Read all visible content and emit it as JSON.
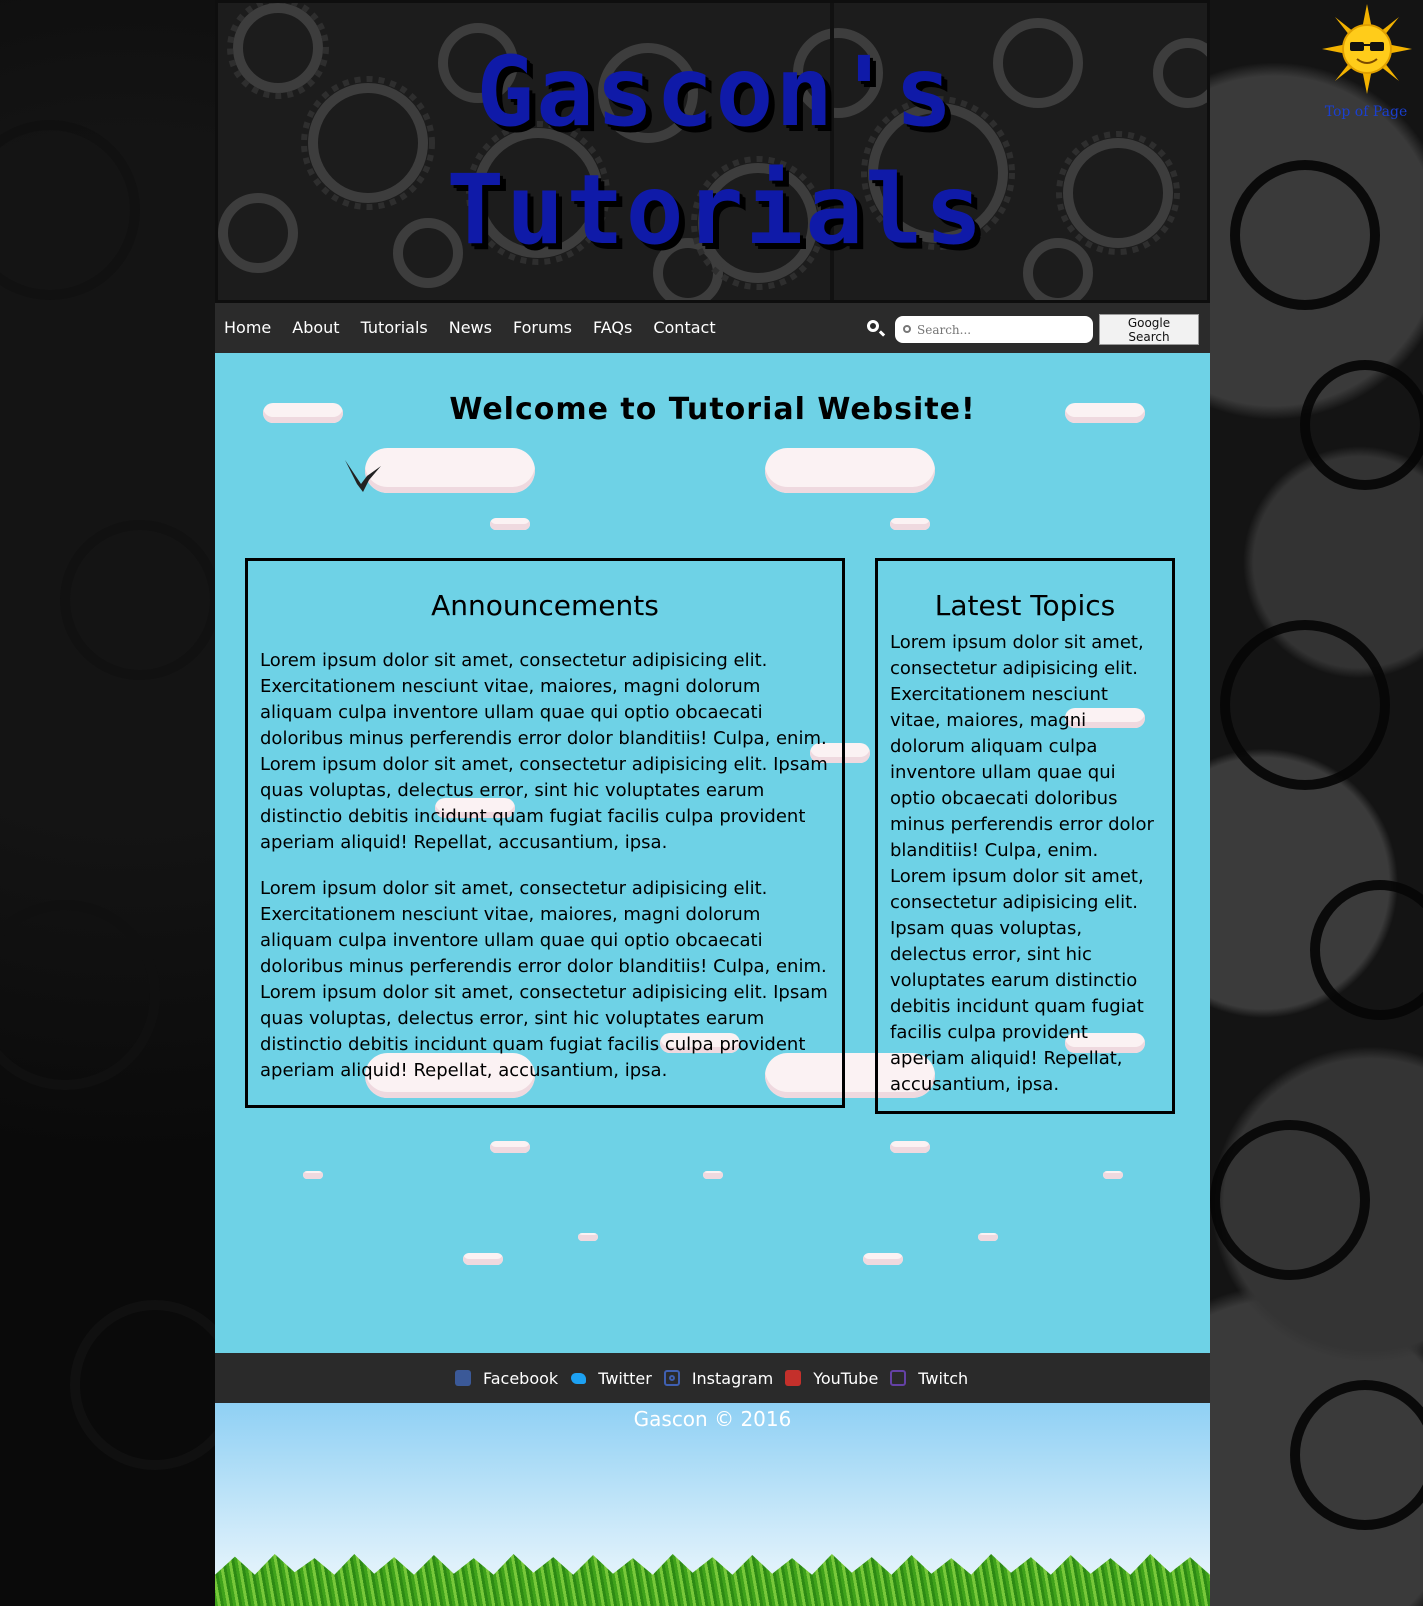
{
  "header": {
    "title_line1": "Gascon's",
    "title_line2": "Tutorials"
  },
  "nav": {
    "items": [
      "Home",
      "About",
      "Tutorials",
      "News",
      "Forums",
      "FAQs",
      "Contact"
    ],
    "search_placeholder": "Search...",
    "search_button": "Google Search"
  },
  "main": {
    "welcome": "Welcome to Tutorial Website!",
    "announcements": {
      "title": "Announcements",
      "paragraphs": [
        "Lorem ipsum dolor sit amet, consectetur adipisicing elit. Exercitationem nesciunt vitae, maiores, magni dolorum aliquam culpa inventore ullam quae qui optio obcaecati doloribus minus perferendis error dolor blanditiis! Culpa, enim. Lorem ipsum dolor sit amet, consectetur adipisicing elit. Ipsam quas voluptas, delectus error, sint hic voluptates earum distinctio debitis incidunt quam fugiat facilis culpa provident aperiam aliquid! Repellat, accusantium, ipsa.",
        "Lorem ipsum dolor sit amet, consectetur adipisicing elit. Exercitationem nesciunt vitae, maiores, magni dolorum aliquam culpa inventore ullam quae qui optio obcaecati doloribus minus perferendis error dolor blanditiis! Culpa, enim. Lorem ipsum dolor sit amet, consectetur adipisicing elit. Ipsam quas voluptas, delectus error, sint hic voluptates earum distinctio debitis incidunt quam fugiat facilis culpa provident aperiam aliquid! Repellat, accusantium, ipsa."
      ]
    },
    "latest_topics": {
      "title": "Latest Topics",
      "text": "Lorem ipsum dolor sit amet, consectetur adipisicing elit. Exercitationem nesciunt vitae, maiores, magni dolorum aliquam culpa inventore ullam quae qui optio obcaecati doloribus minus perferendis error dolor blanditiis! Culpa, enim. Lorem ipsum dolor sit amet, consectetur adipisicing elit. Ipsam quas voluptas, delectus error, sint hic voluptates earum distinctio debitis incidunt quam fugiat facilis culpa provident aperiam aliquid! Repellat, accusantium, ipsa."
    }
  },
  "footer": {
    "social": [
      {
        "label": "Facebook",
        "icon": "facebook-icon"
      },
      {
        "label": "Twitter",
        "icon": "twitter-icon"
      },
      {
        "label": "Instagram",
        "icon": "instagram-icon"
      },
      {
        "label": "YouTube",
        "icon": "youtube-icon"
      },
      {
        "label": "Twitch",
        "icon": "twitch-icon"
      }
    ],
    "copyright": "Gascon © 2016"
  },
  "top_link": {
    "label": "Top of Page",
    "icon": "sun-icon"
  },
  "colors": {
    "title": "#0f1aa8",
    "content_bg": "#6ed2e6",
    "bar_bg": "#2b2b2b"
  }
}
